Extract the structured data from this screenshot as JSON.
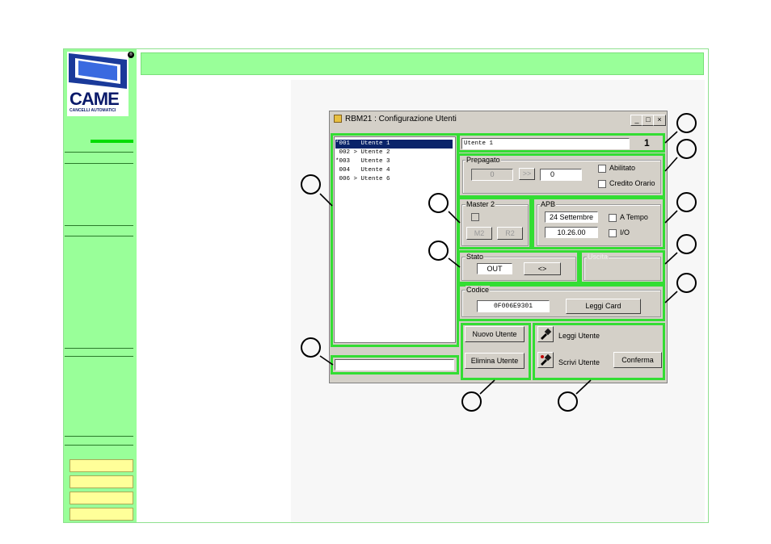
{
  "logo": {
    "brand": "CAME",
    "tagline": "CANCELLI AUTOMATICI",
    "registered": "®"
  },
  "window": {
    "title": "RBM21 : Configurazione Utenti",
    "buttons": [
      "_",
      "□",
      "×"
    ]
  },
  "user_list": {
    "items": [
      {
        "text": "*001   Utente 1",
        "selected": true
      },
      {
        "text": " 002 > Utente 2",
        "selected": false
      },
      {
        "text": "*003   Utente 3",
        "selected": false
      },
      {
        "text": " 004   Utente 4",
        "selected": false
      },
      {
        "text": " 006 > Utente 6",
        "selected": false
      }
    ]
  },
  "bottom_field": {
    "value": ""
  },
  "user_name": {
    "value": "Utente 1",
    "number": "1"
  },
  "prepagato": {
    "legend": "Prepagato",
    "value1": "0",
    "arrow": ">>",
    "value2": "0",
    "abilitato": "Abilitato",
    "credito_orario": "Credito Orario"
  },
  "master2": {
    "legend": "Master 2",
    "m2": "M2",
    "r2": "R2"
  },
  "apb": {
    "legend": "APB",
    "date": "24 Settembre",
    "time": "10.26.00",
    "a_tempo": "A Tempo",
    "io": "I/O"
  },
  "stato": {
    "legend": "Stato",
    "value": "OUT",
    "toggle": "<>"
  },
  "uscita": {
    "legend": "Uscita"
  },
  "codice": {
    "legend": "Codice",
    "value": "0F006E9301",
    "read_card": "Leggi Card"
  },
  "actions": {
    "nuovo_utente": "Nuovo Utente",
    "elimina_utente": "Elimina Utente",
    "leggi_utente": "Leggi Utente",
    "scrivi_utente": "Scrivi Utente",
    "conferma": "Conferma"
  },
  "colors": {
    "highlight_green": "#33dd33",
    "sidebar_green": "#99ff99",
    "nav_yellow": "#ffff99",
    "selection_blue": "#0a246a"
  }
}
